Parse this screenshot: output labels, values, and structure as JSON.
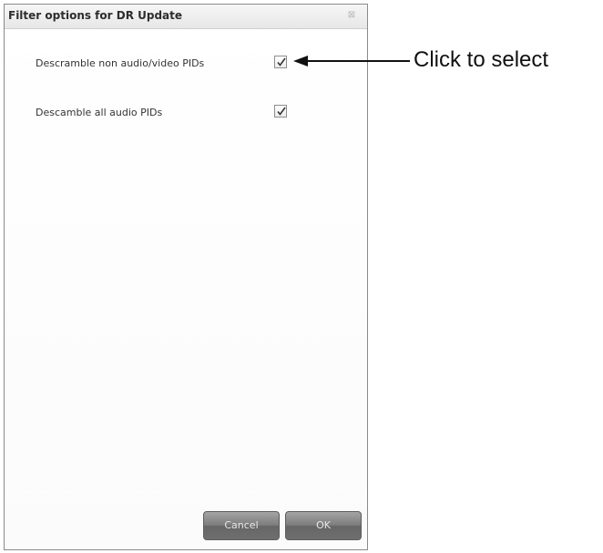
{
  "dialog": {
    "title": "Filter options for DR Update",
    "close_glyph": "⊠",
    "options": [
      {
        "label": "Descramble non audio/video PIDs",
        "checked": true
      },
      {
        "label": "Descamble all audio PIDs",
        "checked": true
      }
    ],
    "buttons": {
      "cancel_label": "Cancel",
      "ok_label": "OK"
    }
  },
  "annotation": {
    "text": "Click to select",
    "arrow_icon": "left-arrow-icon"
  }
}
